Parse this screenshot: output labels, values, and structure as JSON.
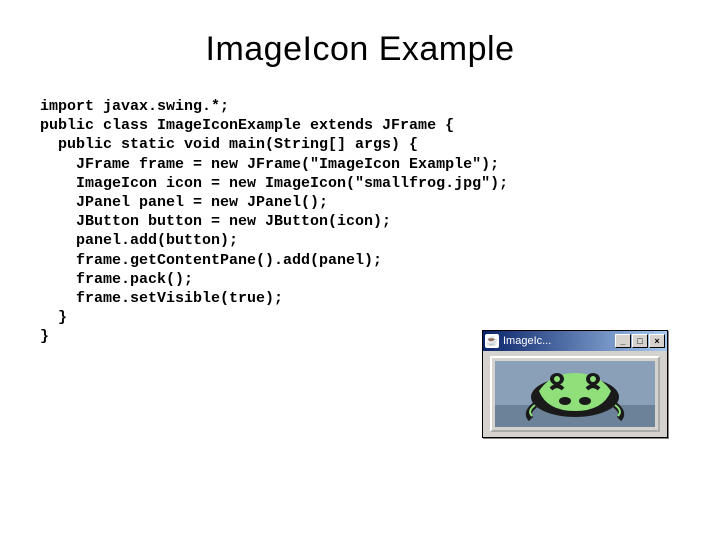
{
  "title": "ImageIcon Example",
  "code_lines": [
    "import javax.swing.*;",
    "public class ImageIconExample extends JFrame {",
    "  public static void main(String[] args) {",
    "    JFrame frame = new JFrame(\"ImageIcon Example\");",
    "    ImageIcon icon = new ImageIcon(\"smallfrog.jpg\");",
    "    JPanel panel = new JPanel();",
    "    JButton button = new JButton(icon);",
    "    panel.add(button);",
    "    frame.getContentPane().add(panel);",
    "    frame.pack();",
    "    frame.setVisible(true);",
    "  }",
    "}"
  ],
  "window": {
    "title": "ImageIc...",
    "app_icon_glyph": "☕",
    "buttons": {
      "min": "_",
      "max": "□",
      "close": "×"
    },
    "image_alt": "smallfrog.jpg"
  }
}
